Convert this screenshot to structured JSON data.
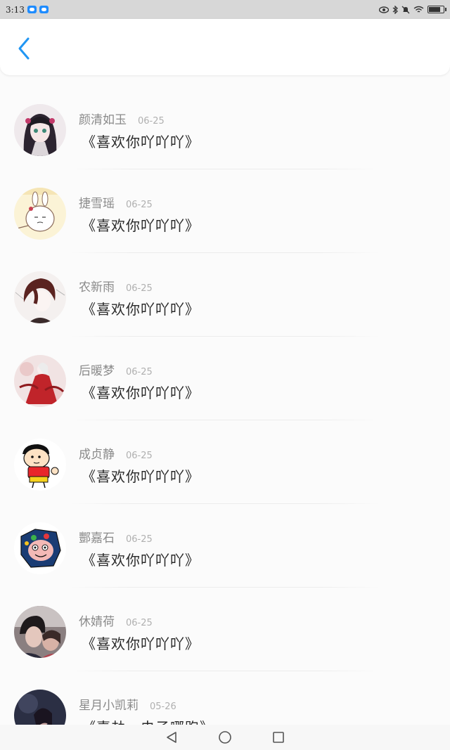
{
  "status_bar": {
    "time": "3:13",
    "icons": [
      "cloud-icon",
      "cloud-icon",
      "eye-icon",
      "bluetooth-icon",
      "mute-icon",
      "wifi-icon",
      "battery-icon"
    ]
  },
  "header": {
    "back_icon": "chevron-left-icon",
    "accent": "#2196f3"
  },
  "items": [
    {
      "name": "颜清如玉",
      "date": "06-25",
      "message": "《喜欢你吖吖吖》",
      "avatar": "anime-girl-avatar"
    },
    {
      "name": "捷雪瑶",
      "date": "06-25",
      "message": "《喜欢你吖吖吖》",
      "avatar": "bunny-avatar"
    },
    {
      "name": "农新雨",
      "date": "06-25",
      "message": "《喜欢你吖吖吖》",
      "avatar": "sketch-boy-avatar"
    },
    {
      "name": "后暖梦",
      "date": "06-25",
      "message": "《喜欢你吖吖吖》",
      "avatar": "red-dress-avatar"
    },
    {
      "name": "成贞静",
      "date": "06-25",
      "message": "《喜欢你吖吖吖》",
      "avatar": "cartoon-kid-avatar"
    },
    {
      "name": "酆嘉石",
      "date": "06-25",
      "message": "《喜欢你吖吖吖》",
      "avatar": "cartoon-face-avatar"
    },
    {
      "name": "休婧荷",
      "date": "06-25",
      "message": "《喜欢你吖吖吖》",
      "avatar": "couple-photo-avatar"
    },
    {
      "name": "星月小凯莉",
      "date": "05-26",
      "message": "《喜劫、虫子哪跑》",
      "avatar": "dark-photo-avatar"
    }
  ],
  "nav_bar": {
    "buttons": [
      "back-triangle-icon",
      "home-circle-icon",
      "recents-square-icon"
    ]
  }
}
